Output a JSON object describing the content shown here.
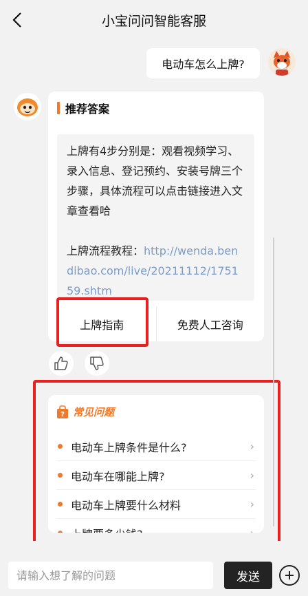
{
  "header": {
    "title": "小宝问问智能客服",
    "back_icon": "back-icon"
  },
  "user_message": {
    "text": "电动车怎么上牌?"
  },
  "answer": {
    "title": "推荐答案",
    "body": "上牌有4步分别是：观看视频学习、录入信息、登记预约、安装号牌三个步骤，具体流程可以点击链接进入文章查看哈",
    "link_label": "上牌流程教程：",
    "link_url": "http://wenda.bendibao.com/live/20211112/175159.shtm",
    "buttons": [
      "上牌指南",
      "免费人工咨询"
    ]
  },
  "feedback": {
    "like_icon": "thumbs-up-icon",
    "dislike_icon": "thumbs-down-icon"
  },
  "faq": {
    "title": "常见问题",
    "items": [
      "电动车上牌条件是什么?",
      "电动车在哪能上牌?",
      "电动车上牌要什么材料",
      "上牌要多少钱?"
    ]
  },
  "input_bar": {
    "placeholder": "请输入想了解的问题",
    "send_label": "发送",
    "plus_icon": "plus-icon"
  },
  "colors": {
    "accent": "#f07a2c",
    "highlight": "#e8201f",
    "link": "#7a9ccc",
    "send_bg": "#232323",
    "page_bg": "#f2f2f2"
  }
}
